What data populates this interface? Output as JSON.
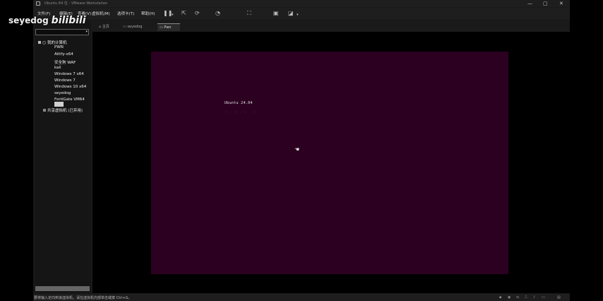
{
  "window": {
    "title": "Ubuntu 64 位 - VMware Workstation"
  },
  "window_controls": {
    "minimize": "—",
    "maximize": "▢",
    "close": "✕"
  },
  "menu": [
    "文件(F)",
    "编辑(E)",
    "查看(V)",
    "虚拟机(M)",
    "选项卡(T)",
    "帮助(H)"
  ],
  "toolbar": [
    "pause-icon",
    "send-ctrl-alt-del-icon",
    "snapshot-icon",
    "revert-snapshot-icon",
    "manage-snapshots-icon",
    "fit-guest-icon",
    "fullscreen-icon"
  ],
  "library": {
    "root": "我的计算机",
    "vms": [
      "PWN",
      "Attify-x64",
      "安全狗 WAF",
      "kali",
      "Windows 7 x64",
      "Windows 7",
      "Windows 10 x64",
      "seyedog",
      "FortiGate VM64",
      ""
    ],
    "shared": "共享虚拟机 (已弃用)"
  },
  "tabs": [
    {
      "label": "主页",
      "active": false
    },
    {
      "label": "seyedog",
      "active": false
    },
    {
      "label": "Pwn",
      "active": true
    }
  ],
  "guest": {
    "boot_text": "Ubuntu 24.04",
    "progress_dots": "· · · ·",
    "background": "#2c0021"
  },
  "status": {
    "text": "要将输入定向到该虚拟机，请在虚拟机内部单击或按 Ctrl+G。"
  },
  "watermark": {
    "text": "seyedog",
    "logo": "bilibili"
  }
}
